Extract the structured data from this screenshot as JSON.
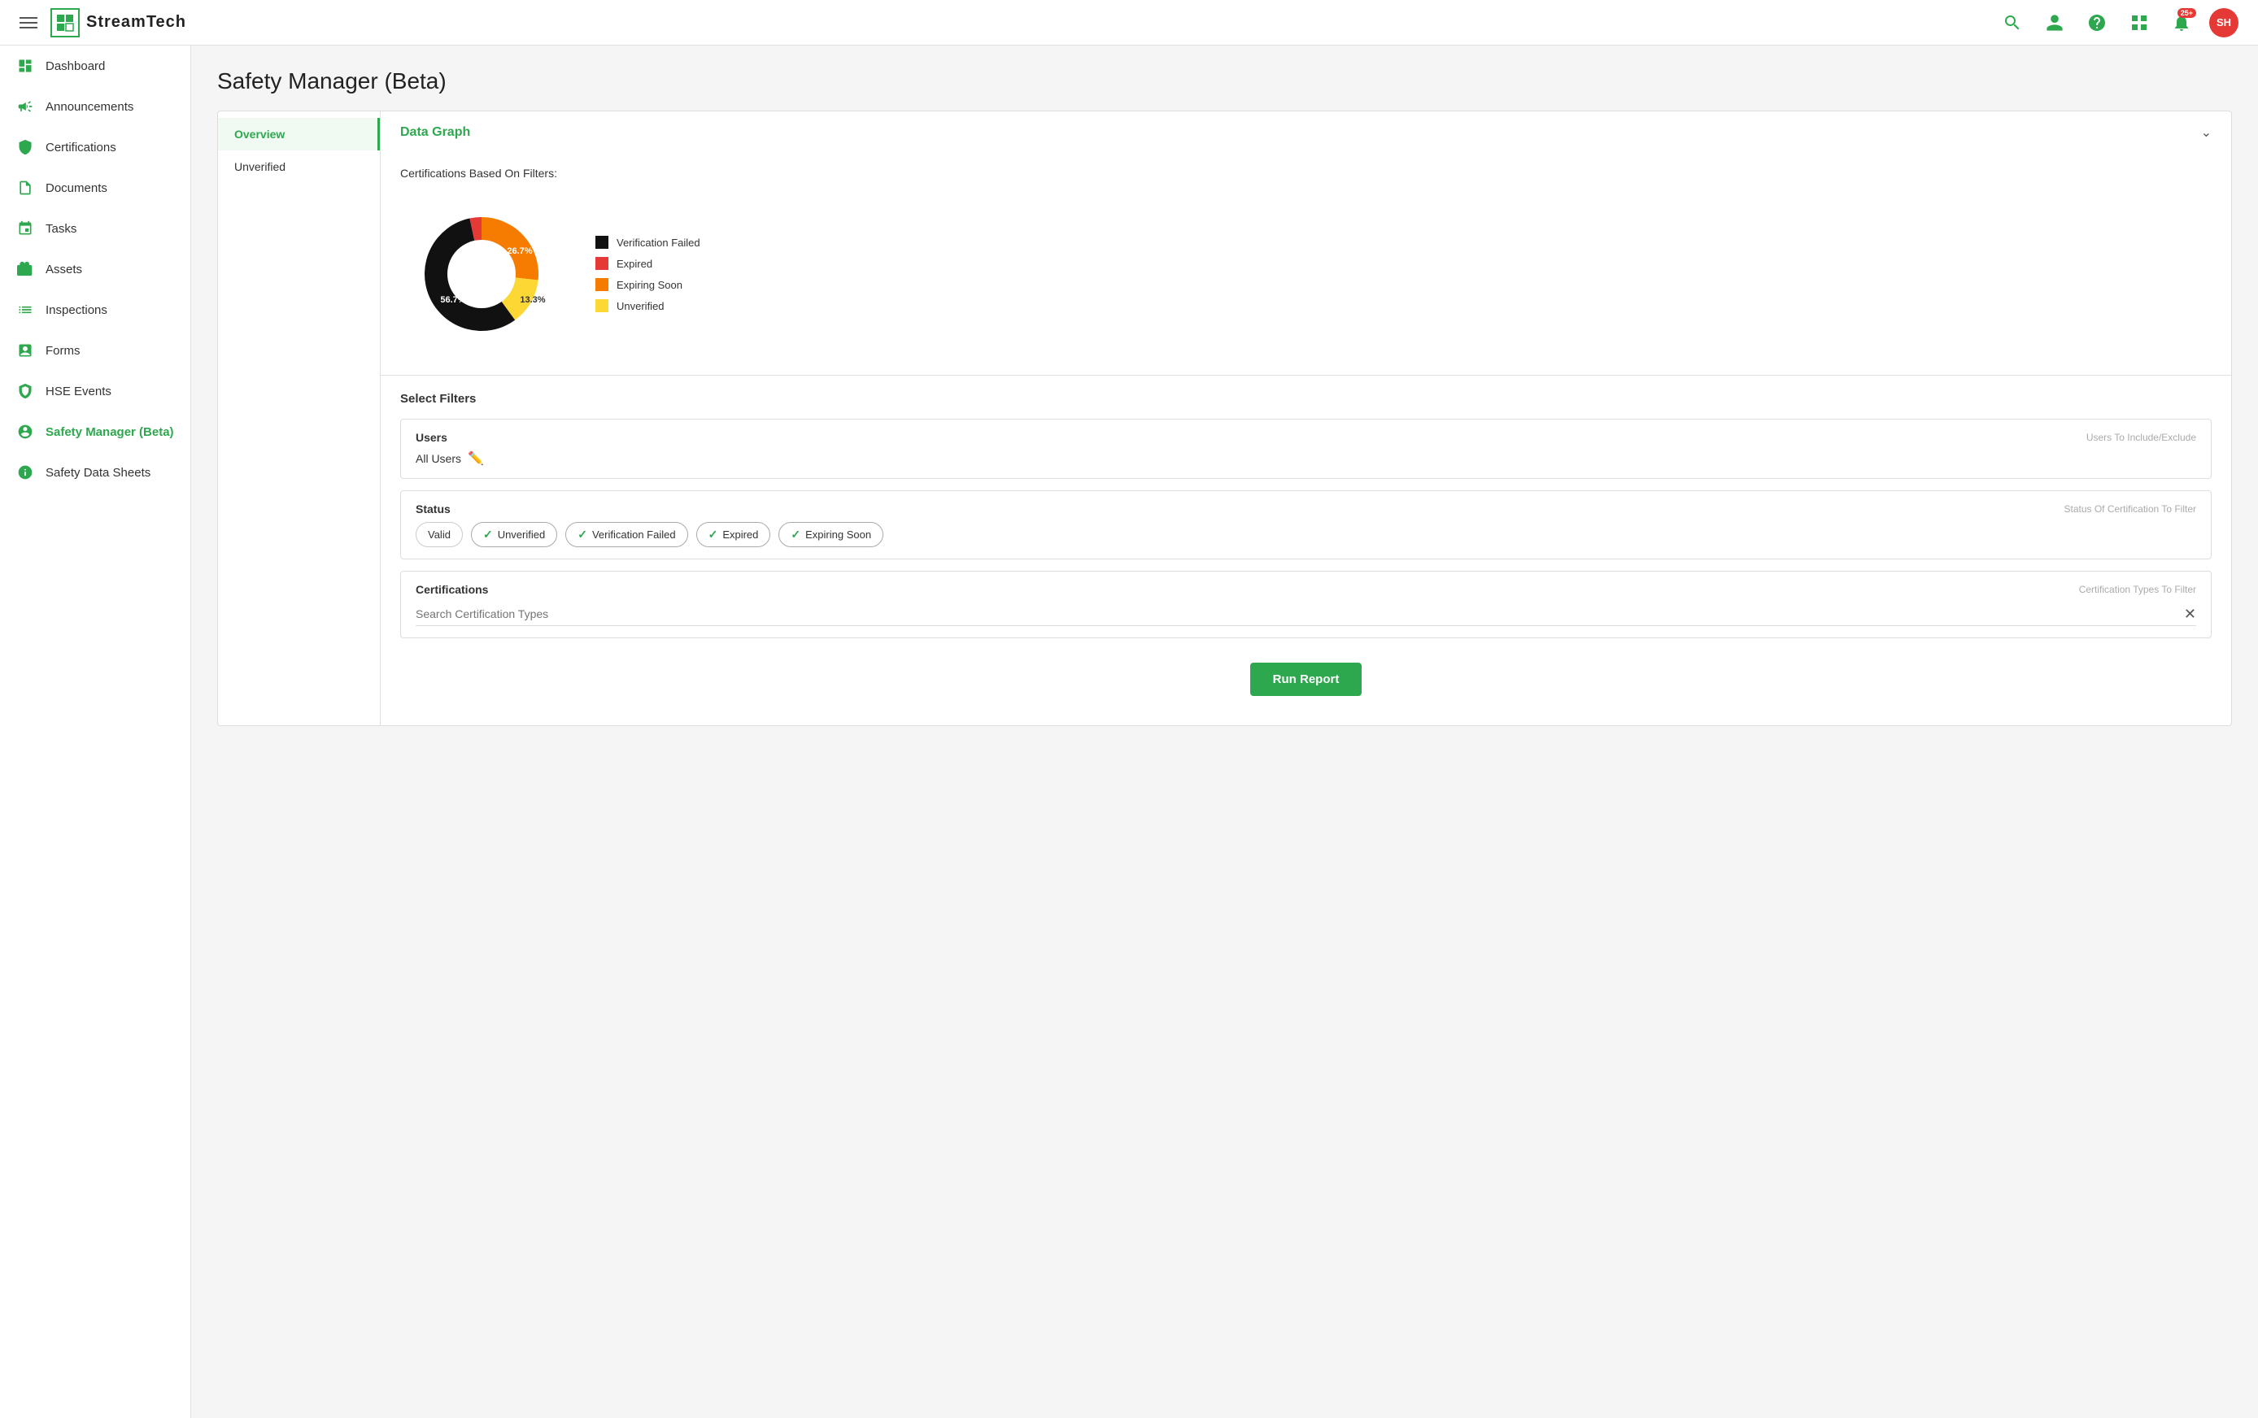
{
  "app": {
    "name": "StreamTech"
  },
  "header": {
    "hamburger_label": "Menu",
    "logo_text": "StreamTech",
    "notification_count": "25+",
    "avatar_initials": "SH"
  },
  "sidebar": {
    "items": [
      {
        "id": "dashboard",
        "label": "Dashboard",
        "icon": "dashboard-icon"
      },
      {
        "id": "announcements",
        "label": "Announcements",
        "icon": "announcements-icon"
      },
      {
        "id": "certifications",
        "label": "Certifications",
        "icon": "certifications-icon"
      },
      {
        "id": "documents",
        "label": "Documents",
        "icon": "documents-icon"
      },
      {
        "id": "tasks",
        "label": "Tasks",
        "icon": "tasks-icon"
      },
      {
        "id": "assets",
        "label": "Assets",
        "icon": "assets-icon"
      },
      {
        "id": "inspections",
        "label": "Inspections",
        "icon": "inspections-icon"
      },
      {
        "id": "forms",
        "label": "Forms",
        "icon": "forms-icon"
      },
      {
        "id": "hse-events",
        "label": "HSE Events",
        "icon": "hse-events-icon"
      },
      {
        "id": "safety-manager",
        "label": "Safety Manager (Beta)",
        "icon": "safety-manager-icon",
        "active": true
      },
      {
        "id": "safety-data-sheets",
        "label": "Safety Data Sheets",
        "icon": "safety-data-sheets-icon"
      }
    ]
  },
  "page": {
    "title": "Safety Manager (Beta)"
  },
  "sub_nav": {
    "items": [
      {
        "id": "overview",
        "label": "Overview",
        "active": true
      },
      {
        "id": "unverified",
        "label": "Unverified",
        "active": false
      }
    ]
  },
  "data_graph": {
    "section_title": "Data Graph",
    "chart_label": "Certifications Based On Filters:",
    "segments": [
      {
        "label": "Verification Failed",
        "color": "#111111",
        "percentage": 56.7,
        "display": "56.7%"
      },
      {
        "label": "Expired",
        "color": "#e53935",
        "percentage": 3.3,
        "display": "3.3%"
      },
      {
        "label": "Expiring Soon",
        "color": "#f57c00",
        "percentage": 26.7,
        "display": "26.7%"
      },
      {
        "label": "Unverified",
        "color": "#fdd835",
        "percentage": 13.3,
        "display": "13.3%"
      }
    ]
  },
  "filters": {
    "section_title": "Select Filters",
    "users": {
      "label": "Users",
      "hint": "Users To Include/Exclude",
      "value": "All Users"
    },
    "status": {
      "label": "Status",
      "hint": "Status Of Certification To Filter",
      "chips": [
        {
          "label": "Valid",
          "checked": false
        },
        {
          "label": "Unverified",
          "checked": true
        },
        {
          "label": "Verification Failed",
          "checked": true
        },
        {
          "label": "Expired",
          "checked": true
        },
        {
          "label": "Expiring Soon",
          "checked": true
        }
      ]
    },
    "certifications": {
      "label": "Certifications",
      "hint": "Certification Types To Filter",
      "placeholder": "Search Certification Types"
    }
  },
  "buttons": {
    "run_report": "Run Report"
  }
}
